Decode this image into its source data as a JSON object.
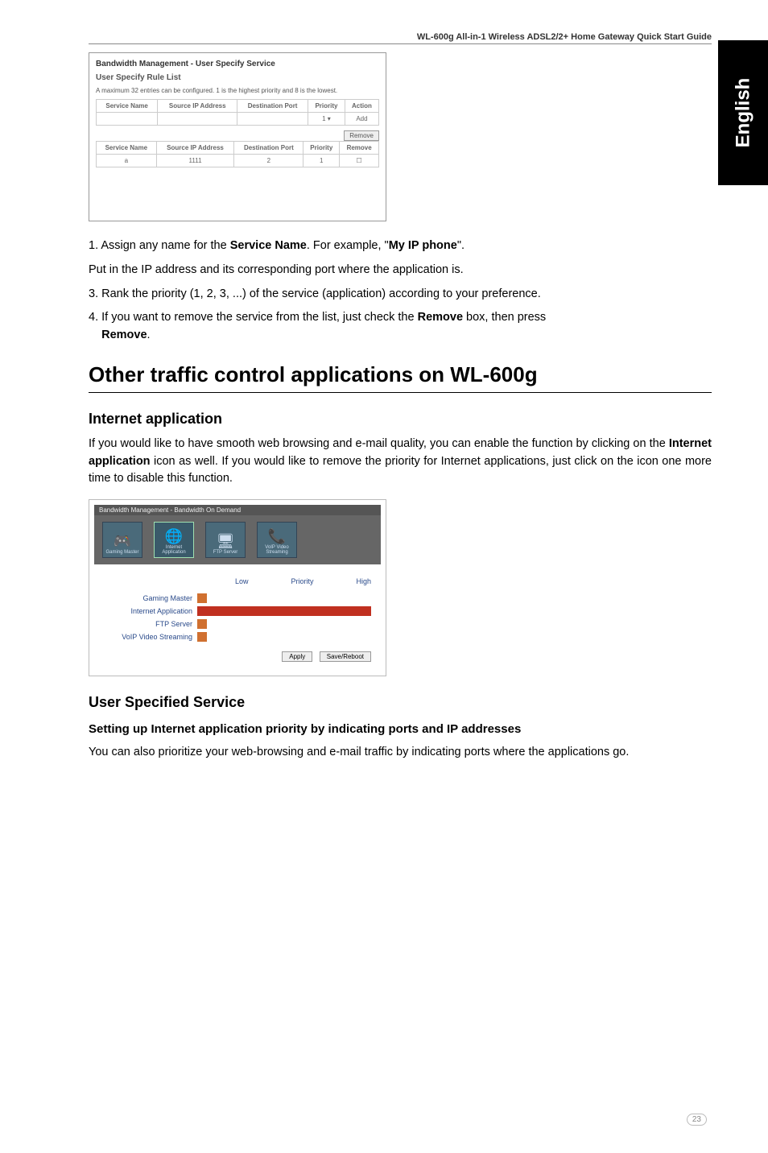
{
  "header": "WL-600g All-in-1 Wireless ADSL2/2+ Home Gateway Quick Start Guide",
  "side_tab": "English",
  "ss1": {
    "title": "Bandwidth Management - User Specify Service",
    "subtitle": "User Specify Rule List",
    "desc": "A maximum 32 entries can be configured. 1 is the highest priority and 8 is the lowest.",
    "cols": [
      "Service Name",
      "Source IP Address",
      "Destination Port",
      "Priority",
      "Action"
    ],
    "r2cols": [
      "Service Name",
      "Source IP Address",
      "Destination Port",
      "Priority",
      "Remove"
    ],
    "row_a": "a",
    "row_ip": "1111",
    "row_port": "2",
    "row_prio": "1",
    "btn_remove": "Remove"
  },
  "p1": "1. Assign any name for the ",
  "p1b": "Service Name",
  "p1c": ". For example, \"",
  "p1d": "My IP phone",
  "p1e": "\".",
  "p2": "Put in the IP address and its corresponding port where the application is.",
  "p3": "3. Rank the priority (1, 2, 3, ...) of the service (application) according to your preference.",
  "p4a": "4. If you want to remove the service from the list, just check the ",
  "p4b": "Remove",
  "p4c": " box, then press ",
  "p4d": "Remove",
  "p4e": ".",
  "h1": "Other traffic control applications on WL-600g",
  "h2a": "Internet application",
  "para_ia_1": "If you would like to have smooth web browsing and e-mail quality, you can enable the function by clicking on the ",
  "para_ia_b": "Internet application",
  "para_ia_2": " icon as well. If you would like to remove the priority for Internet applications, just click on the icon one more time to disable this function.",
  "ss2": {
    "toptitle": "Bandwidth Management - Bandwidth On Demand",
    "icons": [
      "Gaming Master",
      "Internet Application",
      "FTP Server",
      "VoIP Video Streaming"
    ],
    "low": "Low",
    "prio": "Priority",
    "high": "High",
    "rows": [
      "Gaming Master",
      "Internet Application",
      "FTP Server",
      "VoIP Video Streaming"
    ],
    "apply": "Apply",
    "save": "Save/Reboot"
  },
  "h2b": "User Specified Service",
  "h3": "Setting up Internet application priority by indicating ports and IP addresses",
  "para_uss": "You can also prioritize your web-browsing and e-mail traffic by indicating ports where the applications go.",
  "page": "23"
}
